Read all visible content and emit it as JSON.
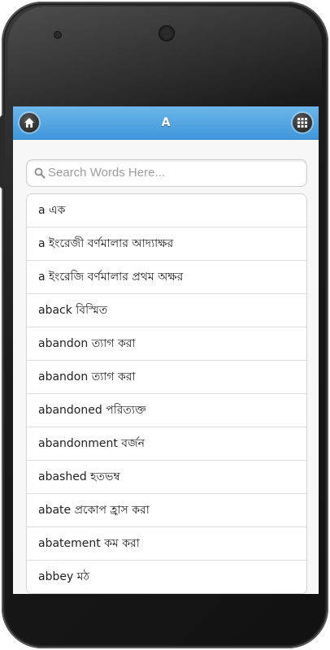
{
  "header": {
    "title": "A",
    "home_icon": "home-icon",
    "menu_icon": "grid-menu-icon"
  },
  "search": {
    "placeholder": "Search Words Here...",
    "value": "",
    "icon": "search-icon"
  },
  "words": [
    {
      "label": "a এক"
    },
    {
      "label": "a ইংরেজী বর্ণমালার আদ্যাক্ষর"
    },
    {
      "label": "a ইংরেজি বর্ণমালার প্রথম অক্ষর"
    },
    {
      "label": "aback বিস্মিত"
    },
    {
      "label": "abandon ত্যাগ করা"
    },
    {
      "label": "abandon ত্যাগ করা"
    },
    {
      "label": "abandoned পরিত্যক্ত"
    },
    {
      "label": "abandonment বর্জন"
    },
    {
      "label": "abashed হতভম্ব"
    },
    {
      "label": "abate প্রকোপ হ্রাস করা"
    },
    {
      "label": "abatement কম করা"
    },
    {
      "label": "abbey মঠ"
    }
  ],
  "colors": {
    "header_top": "#6cb6ea",
    "header_bottom": "#3f96d9",
    "device_body": "#1a1a1a"
  }
}
